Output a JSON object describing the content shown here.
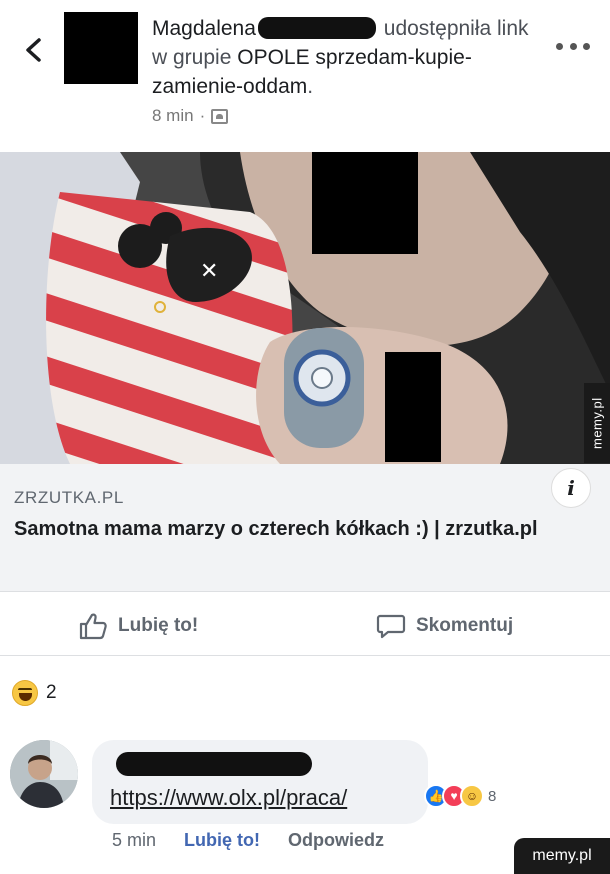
{
  "post": {
    "author_first": "Magdalena",
    "action": "udostępniła link w grupie",
    "group": "OPOLE sprzedam-kupie-zamienie-oddam",
    "period": ".",
    "time": "8 min",
    "separator": "·",
    "visibility_icon": "group-icon"
  },
  "link": {
    "domain": "ZRZUTKA.PL",
    "title": "Samotna mama marzy o czterech kółkach :) | zrzutka.pl",
    "info_label": "i"
  },
  "actions": {
    "like_label": "Lubię to!",
    "comment_label": "Skomentuj"
  },
  "reactions": {
    "count": "2"
  },
  "comment": {
    "text": "https://www.olx.pl/praca/",
    "reaction_count": "8",
    "time": "5 min",
    "like_label": "Lubię to!",
    "reply_label": "Odpowiedz"
  },
  "watermark": "memy.pl"
}
